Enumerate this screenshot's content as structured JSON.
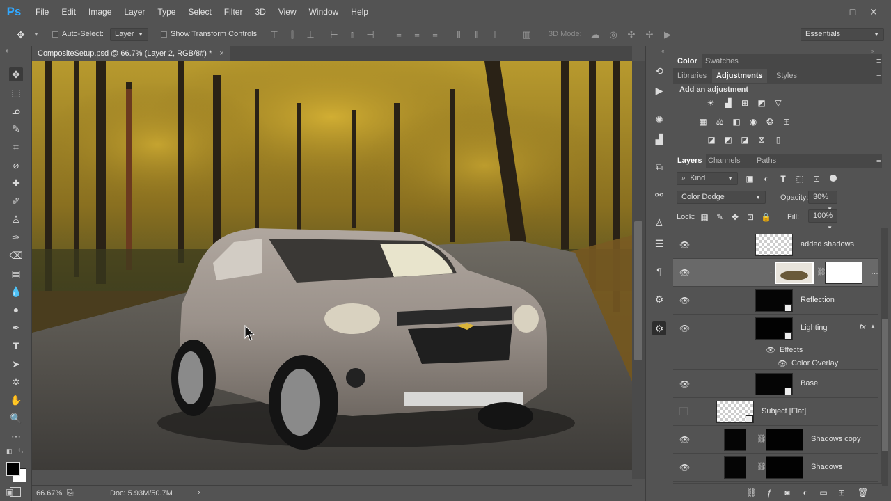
{
  "app": {
    "logo": "Ps"
  },
  "menu": [
    "File",
    "Edit",
    "Image",
    "Layer",
    "Type",
    "Select",
    "Filter",
    "3D",
    "View",
    "Window",
    "Help"
  ],
  "window_controls": {
    "minimize": "—",
    "maximize": "□",
    "close": "✕"
  },
  "options_bar": {
    "auto_select_label": "Auto-Select:",
    "auto_select_target": "Layer",
    "show_transform_label": "Show Transform Controls",
    "mode_3d_label": "3D Mode:",
    "workspace": "Essentials"
  },
  "document_tab": {
    "title": "CompositeSetup.psd @ 66.7% (Layer 2, RGB/8#) *",
    "close": "×"
  },
  "status_bar": {
    "zoom": "66.67%",
    "doc_info": "Doc: 5.93M/50.7M"
  },
  "panels": {
    "color_tabs": [
      "Color",
      "Swatches"
    ],
    "adjust_tabs": [
      "Libraries",
      "Adjustments",
      "Styles"
    ],
    "adjustments_title": "Add an adjustment",
    "layers_tabs": [
      "Layers",
      "Channels",
      "Paths"
    ],
    "filter_kind": "Kind",
    "blend_mode": "Color Dodge",
    "opacity_label": "Opacity:",
    "opacity_value": "30%",
    "lock_label": "Lock:",
    "fill_label": "Fill:",
    "fill_value": "100%"
  },
  "layers": [
    {
      "name": "added shadows"
    },
    {
      "name": ""
    },
    {
      "name": "Reflection"
    },
    {
      "name": "Lighting",
      "fx": "fx",
      "effects_label": "Effects",
      "effect": "Color Overlay"
    },
    {
      "name": "Base"
    },
    {
      "name": "Subject [Flat]"
    },
    {
      "name": "Shadows copy"
    },
    {
      "name": "Shadows"
    }
  ],
  "colors": {
    "ui_bg": "#535353",
    "panel_dark": "#474747",
    "accent": "#31a8ff",
    "selected_layer": "#696969"
  }
}
